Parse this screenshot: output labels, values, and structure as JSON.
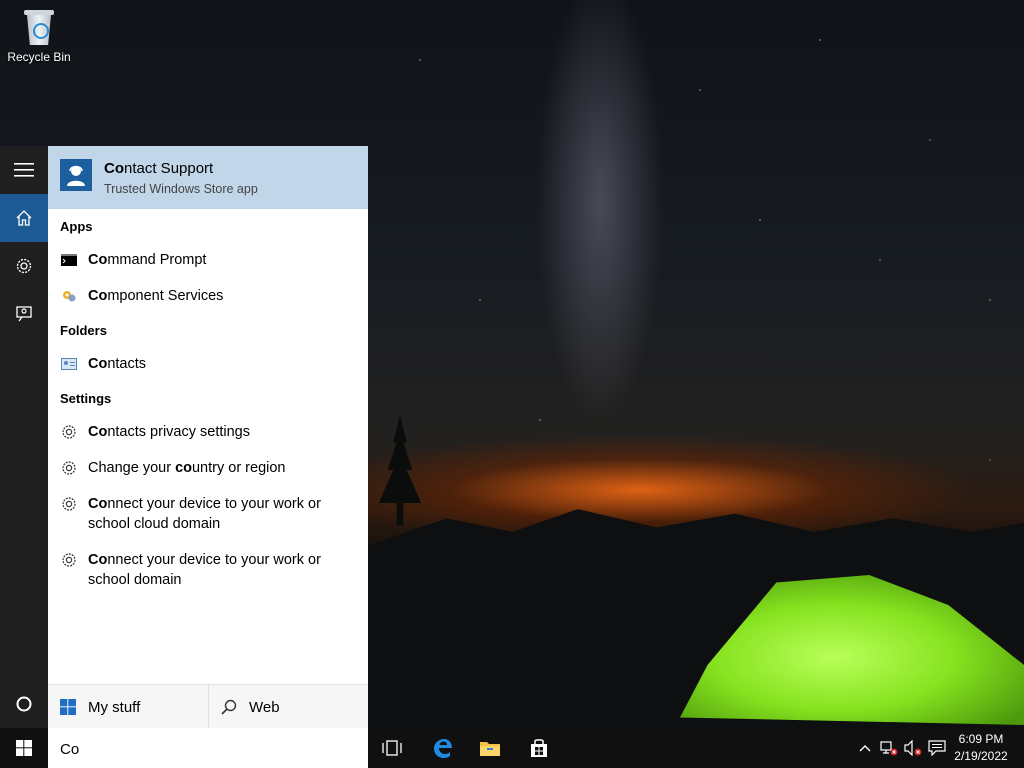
{
  "desktop": {
    "icons": [
      {
        "label": "Recycle Bin",
        "icon": "recycle-bin-icon"
      }
    ]
  },
  "rail": {
    "items": [
      {
        "name": "hamburger-menu",
        "icon": "hamburger-icon"
      },
      {
        "name": "home",
        "icon": "home-icon",
        "active": true
      },
      {
        "name": "settings",
        "icon": "gear-icon"
      },
      {
        "name": "feedback",
        "icon": "feedback-icon"
      }
    ],
    "cortana_icon": "cortana-circle-icon"
  },
  "best_match": {
    "title_highlight": "Co",
    "title_rest": "ntact Support",
    "subtitle": "Trusted Windows Store app"
  },
  "sections": {
    "apps": {
      "header": "Apps",
      "items": [
        {
          "highlight": "Co",
          "rest": "mmand Prompt",
          "icon": "command-prompt-icon"
        },
        {
          "highlight": "Co",
          "rest": "mponent Services",
          "icon": "component-services-icon"
        }
      ]
    },
    "folders": {
      "header": "Folders",
      "items": [
        {
          "highlight": "Co",
          "rest": "ntacts",
          "icon": "contacts-folder-icon"
        }
      ]
    },
    "settings": {
      "header": "Settings",
      "items": [
        {
          "pre": "",
          "highlight": "Co",
          "rest": "ntacts privacy settings",
          "icon": "gear-icon"
        },
        {
          "pre": "Change your ",
          "highlight": "co",
          "rest": "untry or region",
          "icon": "gear-icon"
        },
        {
          "pre": "",
          "highlight": "Co",
          "rest": "nnect your device to your work or school cloud domain",
          "icon": "gear-icon"
        },
        {
          "pre": "",
          "highlight": "Co",
          "rest": "nnect your device to your work or school domain",
          "icon": "gear-icon"
        }
      ]
    }
  },
  "tabs": {
    "my_stuff": "My stuff",
    "web": "Web"
  },
  "search": {
    "value": "Co"
  },
  "taskbar": {
    "pinned": [
      "task-view-icon",
      "edge-icon",
      "file-explorer-icon",
      "store-icon"
    ],
    "tray": [
      "chevron-up-icon",
      "network-icon",
      "volume-muted-icon",
      "action-center-icon"
    ]
  },
  "clock": {
    "time": "6:09 PM",
    "date": "2/19/2022"
  },
  "colors": {
    "accent": "#1e5b94",
    "best_match_bg": "#c1d7e9",
    "rail_bg": "#1f1f1f",
    "taskbar_bg": "#101010"
  }
}
